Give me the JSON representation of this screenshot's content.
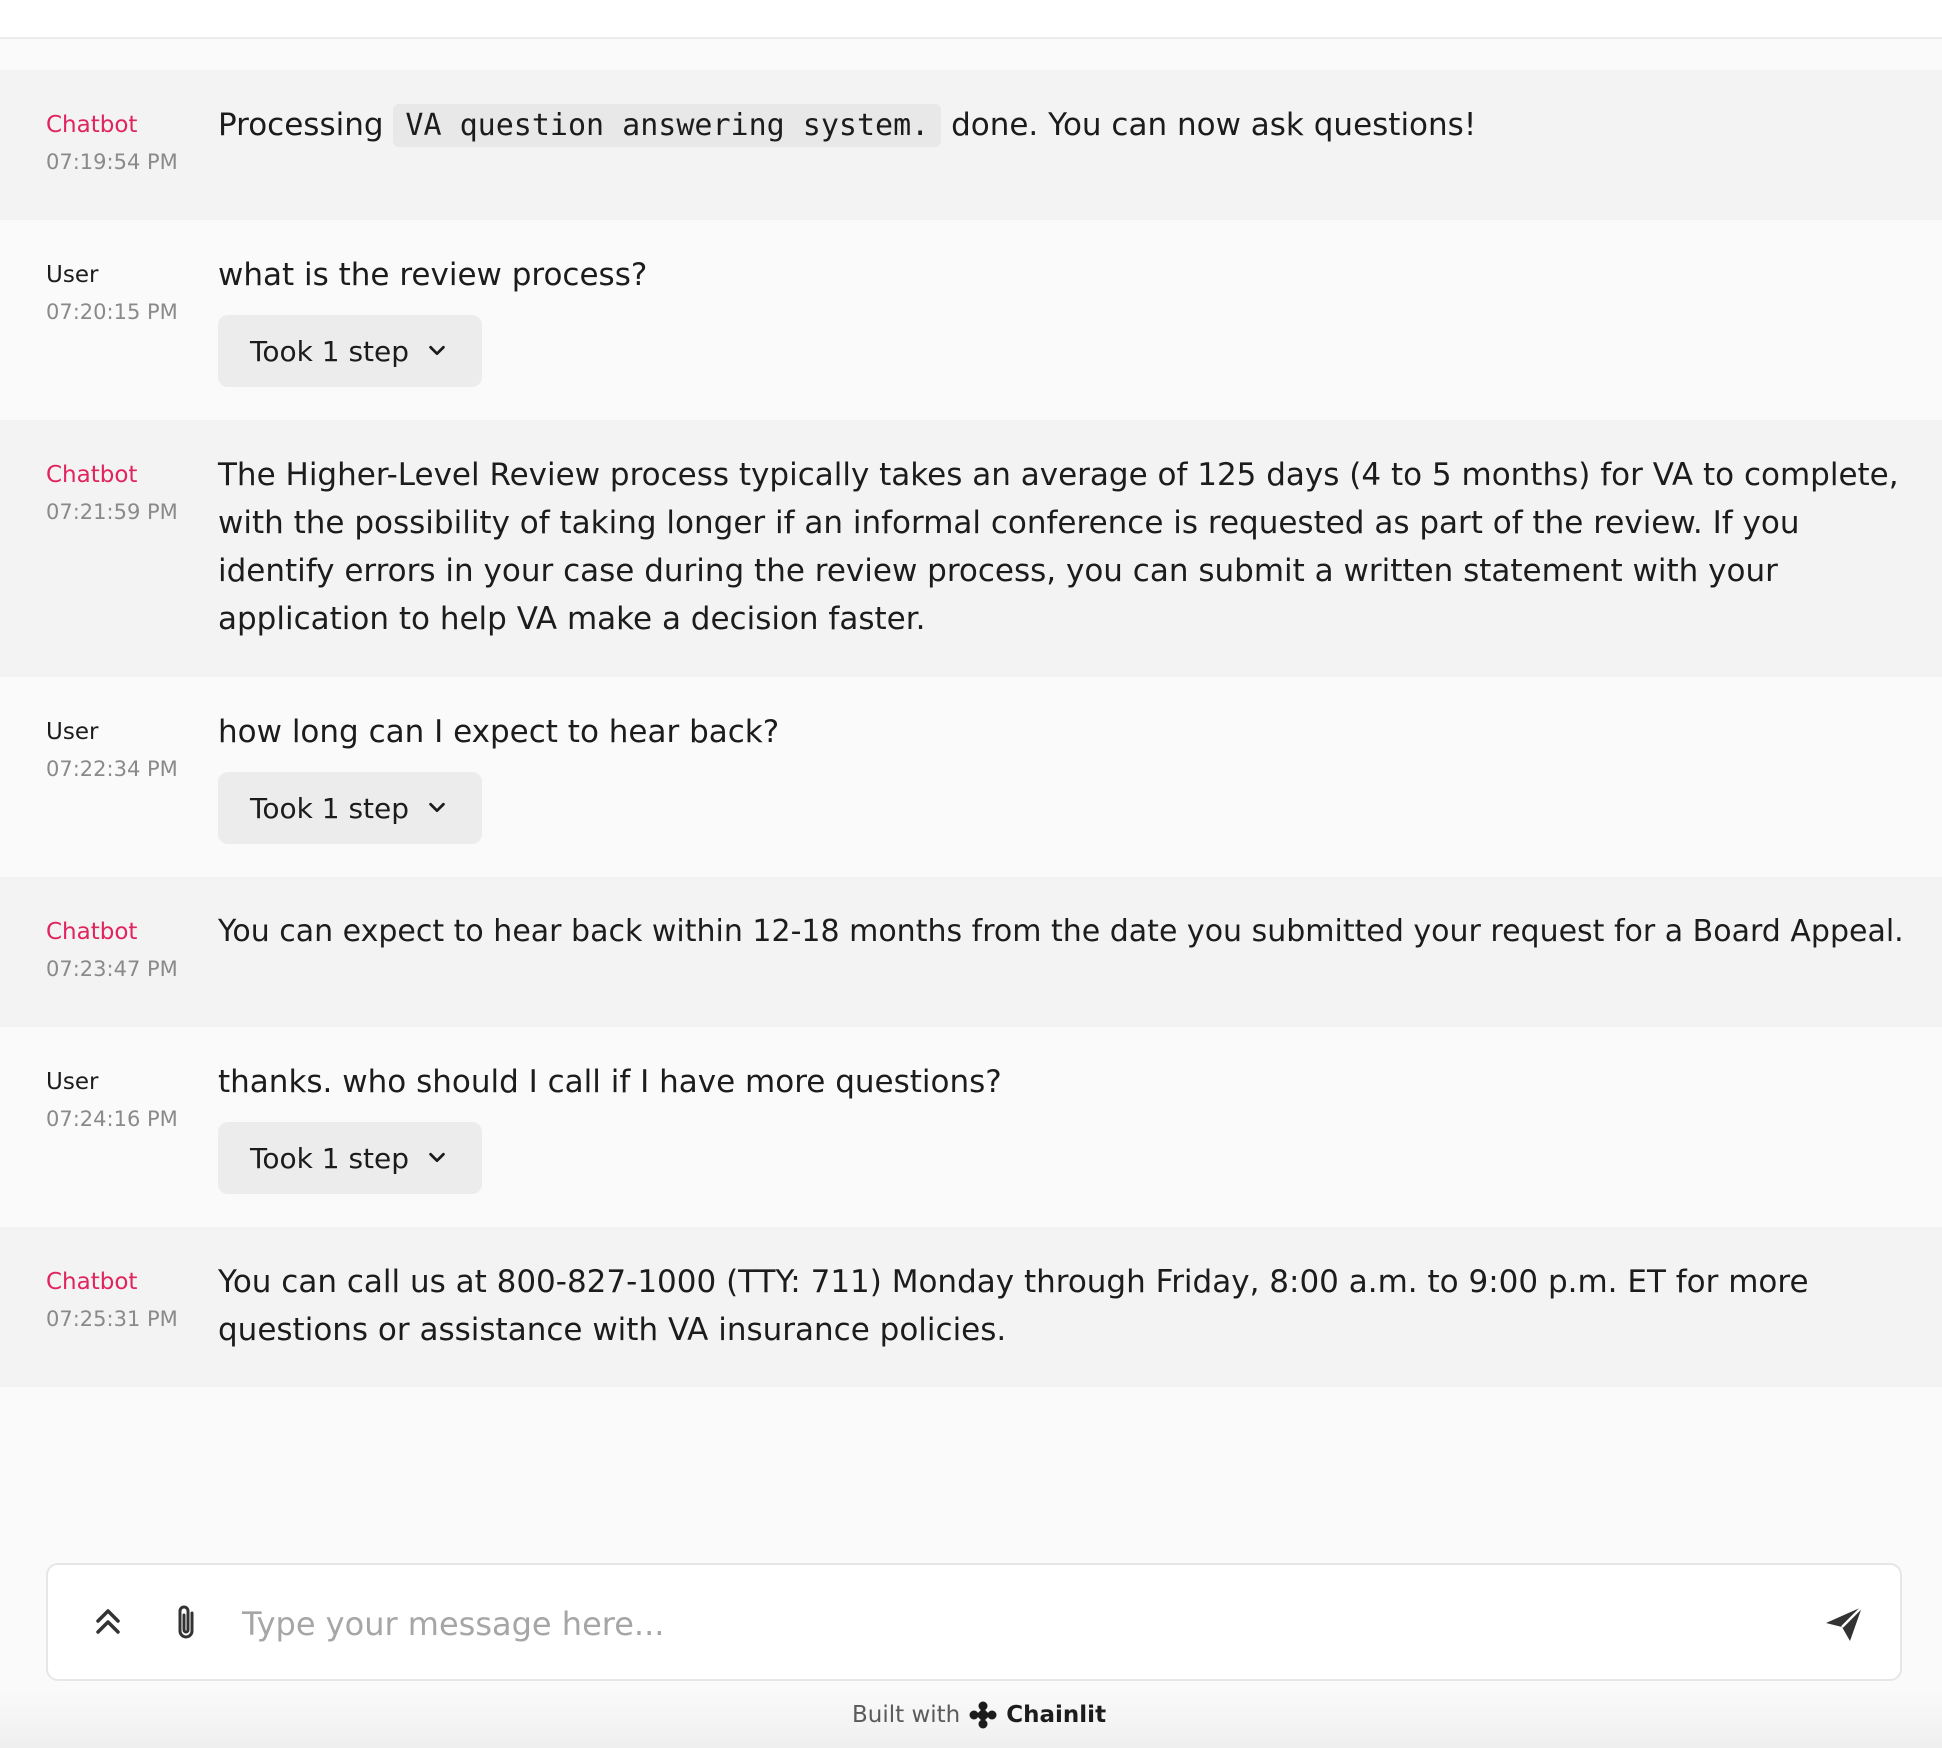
{
  "messages": [
    {
      "author": "Chatbot",
      "time": "07:19:54 PM",
      "text_before": "Processing",
      "code": "VA question answering system.",
      "text_after": "done. You can now ask questions!"
    },
    {
      "author": "User",
      "time": "07:20:15 PM",
      "text": "what is the review process?",
      "step_label": "Took 1 step"
    },
    {
      "author": "Chatbot",
      "time": "07:21:59 PM",
      "text": "The Higher-Level Review process typically takes an average of 125 days (4 to 5 months) for VA to complete, with the possibility of taking longer if an informal conference is requested as part of the review. If you identify errors in your case during the review process, you can submit a written statement with your application to help VA make a decision faster."
    },
    {
      "author": "User",
      "time": "07:22:34 PM",
      "text": "how long can I expect to hear back?",
      "step_label": "Took 1 step"
    },
    {
      "author": "Chatbot",
      "time": "07:23:47 PM",
      "text": "You can expect to hear back within 12-18 months from the date you submitted your request for a Board Appeal."
    },
    {
      "author": "User",
      "time": "07:24:16 PM",
      "text": "thanks. who should I call if I have more questions?",
      "step_label": "Took 1 step"
    },
    {
      "author": "Chatbot",
      "time": "07:25:31 PM",
      "text": "You can call us at 800-827-1000 (TTY: 711) Monday through Friday, 8:00 a.m. to 9:00 p.m. ET for more questions or assistance with VA insurance policies."
    }
  ],
  "composer": {
    "placeholder": "Type your message here...",
    "icons": [
      "expand-up-icon",
      "paperclip-icon",
      "send-icon"
    ]
  },
  "footer": {
    "built_with": "Built with",
    "brand": "Chainlit"
  },
  "colors": {
    "bot_author": "#e0245e",
    "bot_row_bg": "#f3f3f3",
    "user_row_bg": "#fafafa",
    "step_button_bg": "#ececec"
  }
}
